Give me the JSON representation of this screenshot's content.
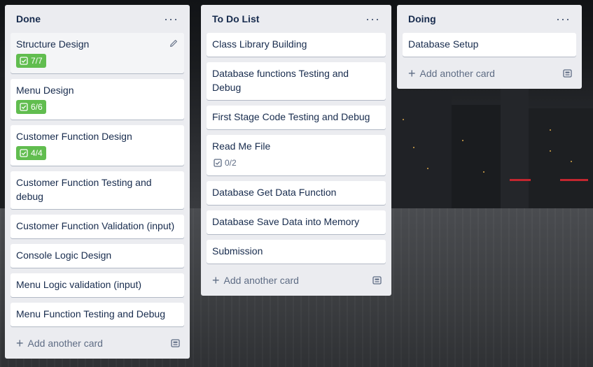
{
  "lists": [
    {
      "title": "Done",
      "menu_glyph": "···",
      "cards": [
        {
          "title": "Structure Design",
          "checklist": "7/7"
        },
        {
          "title": "Menu Design",
          "checklist": "6/6"
        },
        {
          "title": "Customer Function Design",
          "checklist": "4/4"
        },
        {
          "title": "Customer Function Testing and debug"
        },
        {
          "title": "Customer Function Validation (input)"
        },
        {
          "title": "Console Logic Design"
        },
        {
          "title": "Menu Logic validation (input)"
        },
        {
          "title": "Menu Function Testing and Debug"
        }
      ],
      "add_label": "Add another card"
    },
    {
      "title": "To Do List",
      "menu_glyph": "···",
      "cards": [
        {
          "title": "Class Library Building"
        },
        {
          "title": "Database functions Testing and Debug"
        },
        {
          "title": "First Stage Code Testing and Debug"
        },
        {
          "title": "Read Me File",
          "checklist": "0/2"
        },
        {
          "title": "Database Get Data Function"
        },
        {
          "title": "Database Save Data into Memory"
        },
        {
          "title": "Submission"
        }
      ],
      "add_label": "Add another card"
    },
    {
      "title": "Doing",
      "menu_glyph": "···",
      "cards": [
        {
          "title": "Database Setup"
        }
      ],
      "add_label": "Add another card"
    }
  ],
  "icons": {
    "edit": "pencil-icon",
    "checklist": "checklist-icon",
    "add": "plus-icon",
    "template": "card-template-icon",
    "menu": "ellipsis-icon"
  },
  "colors": {
    "list_bg": "#ebecf0",
    "card_bg": "#ffffff",
    "checklist_complete": "#61bd4f",
    "text": "#172b4d"
  }
}
